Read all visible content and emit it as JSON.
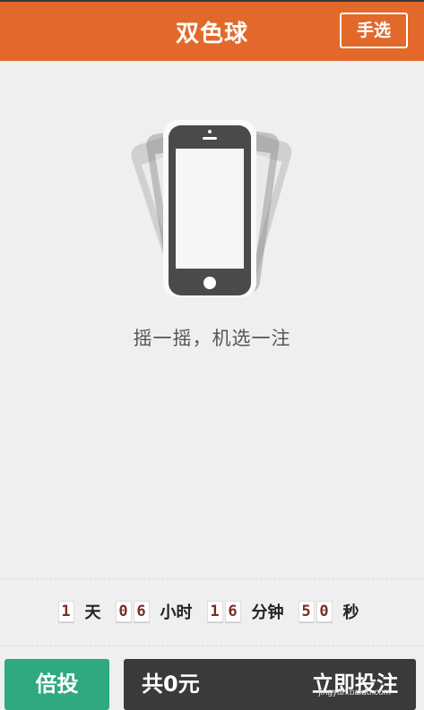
{
  "header": {
    "title": "双色球",
    "manual_select": "手选"
  },
  "shake": {
    "caption": "摇一摇，机选一注"
  },
  "countdown": {
    "days": "1",
    "days_unit": "天",
    "hours": [
      "0",
      "6"
    ],
    "hours_unit": "小时",
    "minutes": [
      "1",
      "6"
    ],
    "minutes_unit": "分钟",
    "seconds": [
      "5",
      "0"
    ],
    "seconds_unit": "秒"
  },
  "footer": {
    "multiple": "倍投",
    "total": "共0元",
    "submit": "立即投注"
  },
  "watermark": "jingyan.baidu.com"
}
